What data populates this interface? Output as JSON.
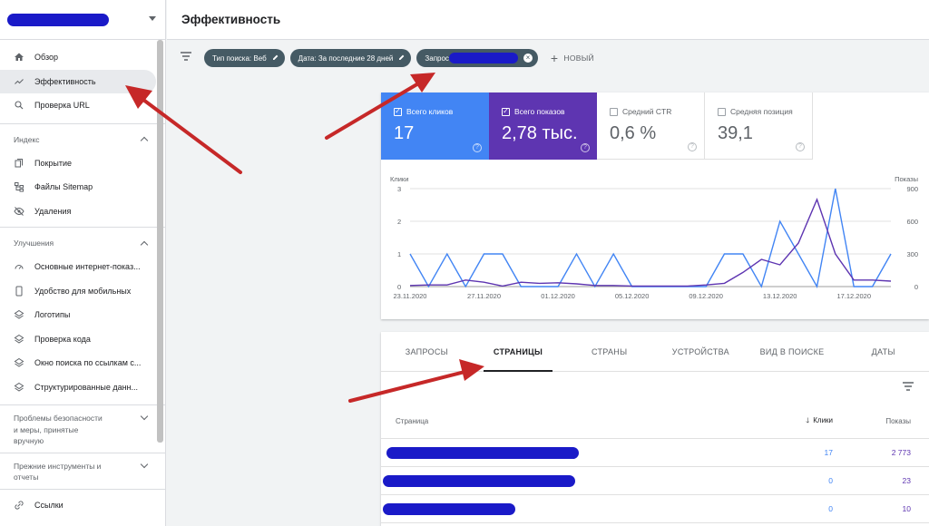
{
  "header": {
    "title": "Эффективность"
  },
  "sidebar": {
    "top_items": [
      {
        "label": "Обзор",
        "icon": "home-icon"
      },
      {
        "label": "Эффективность",
        "icon": "trending-up-icon",
        "active": true
      },
      {
        "label": "Проверка URL",
        "icon": "search-icon"
      }
    ],
    "sections": [
      {
        "title": "Индекс",
        "expanded": true,
        "items": [
          {
            "label": "Покрытие",
            "icon": "file-copy-icon"
          },
          {
            "label": "Файлы Sitemap",
            "icon": "sitemap-icon"
          },
          {
            "label": "Удаления",
            "icon": "eye-off-icon"
          }
        ]
      },
      {
        "title": "Улучшения",
        "expanded": true,
        "items": [
          {
            "label": "Основные интернет-показ...",
            "icon": "gauge-icon"
          },
          {
            "label": "Удобство для мобильных",
            "icon": "smartphone-icon"
          },
          {
            "label": "Логотипы",
            "icon": "layers-icon"
          },
          {
            "label": "Проверка кода",
            "icon": "layers-icon"
          },
          {
            "label": "Окно поиска по ссылкам с...",
            "icon": "layers-icon"
          },
          {
            "label": "Структурированные данн...",
            "icon": "layers-icon"
          }
        ]
      }
    ],
    "security_section": {
      "line1": "Проблемы безопасности",
      "line2": "и меры, принятые",
      "line3": "вручную"
    },
    "legacy_section": {
      "line1": "Прежние инструменты и",
      "line2": "отчеты"
    },
    "links_item": {
      "label": "Ссылки",
      "icon": "link-icon"
    }
  },
  "filters": {
    "chips": [
      {
        "label": "Тип поиска: Веб"
      },
      {
        "label": "Дата: За последние 28 дней"
      },
      {
        "label": "Запрос"
      }
    ],
    "new_label": "НОВЫЙ"
  },
  "metrics": [
    {
      "label": "Всего кликов",
      "value": "17",
      "checked": true,
      "color": "#4285f4"
    },
    {
      "label": "Всего показов",
      "value": "2,78 тыс.",
      "checked": true,
      "color": "#5e35b1"
    },
    {
      "label": "Средний CTR",
      "value": "0,6 %",
      "checked": false
    },
    {
      "label": "Средняя позиция",
      "value": "39,1",
      "checked": false
    }
  ],
  "chart_data": {
    "type": "line",
    "left_axis_label": "Клики",
    "right_axis_label": "Показы",
    "left_ticks": [
      "3",
      "2",
      "1",
      "0"
    ],
    "right_ticks": [
      "900",
      "600",
      "300",
      "0"
    ],
    "ylim_left": [
      0,
      3
    ],
    "ylim_right": [
      0,
      900
    ],
    "x_tick_labels": [
      "23.11.2020",
      "27.11.2020",
      "01.12.2020",
      "05.12.2020",
      "09.12.2020",
      "13.12.2020",
      "17.12.2020"
    ],
    "x_tick_index": [
      0,
      4,
      8,
      12,
      16,
      20,
      24
    ],
    "series": [
      {
        "color": "#4285f4",
        "axis": "left",
        "values": [
          1,
          0,
          1,
          0,
          1,
          1,
          0,
          0,
          0,
          1,
          0,
          1,
          0,
          0,
          0,
          0,
          0,
          1,
          1,
          0,
          2,
          1,
          0,
          3,
          0,
          0,
          1
        ]
      },
      {
        "color": "#5e35b1",
        "axis": "right",
        "values": [
          10,
          15,
          15,
          60,
          40,
          5,
          40,
          30,
          35,
          25,
          10,
          10,
          5,
          5,
          5,
          5,
          15,
          30,
          130,
          250,
          200,
          400,
          800,
          300,
          60,
          60,
          50
        ]
      }
    ]
  },
  "table": {
    "tabs": [
      "ЗАПРОСЫ",
      "СТРАНИЦЫ",
      "СТРАНЫ",
      "УСТРОЙСТВА",
      "ВИД В ПОИСКЕ",
      "ДАТЫ"
    ],
    "active_tab": 1,
    "columns": {
      "page": "Страница",
      "clicks": "Клики",
      "impressions": "Показы"
    },
    "rows": [
      {
        "clicks": "17",
        "impressions": "2 773"
      },
      {
        "clicks": "0",
        "impressions": "23"
      },
      {
        "clicks": "0",
        "impressions": "10"
      }
    ]
  }
}
